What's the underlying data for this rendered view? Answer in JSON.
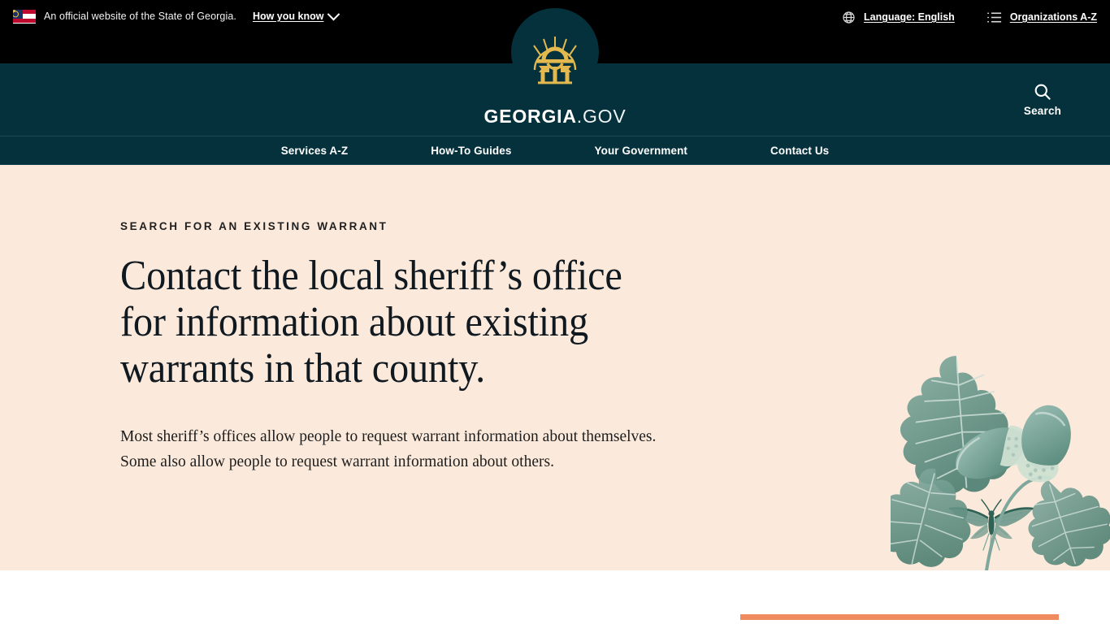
{
  "gov_banner": {
    "flag_icon": "georgia-state-flag-icon",
    "official_text": "An official website of the State of Georgia.",
    "how_you_know_label": "How you know",
    "chevron_icon": "chevron-down-icon",
    "language": {
      "icon": "globe-icon",
      "label": "Language: English"
    },
    "organizations": {
      "icon": "list-icon",
      "label": "Organizations A-Z"
    },
    "background_color": "#000000"
  },
  "header": {
    "seal_icon": "georgia-state-seal-icon",
    "wordmark_bold": "GEORGIA",
    "wordmark_light": ".GOV",
    "search": {
      "icon": "search-icon",
      "label": "Search"
    },
    "background_color": "#04313c"
  },
  "nav": {
    "items": [
      {
        "label": "Services A-Z"
      },
      {
        "label": "How-To Guides"
      },
      {
        "label": "Your Government"
      },
      {
        "label": "Contact Us"
      }
    ]
  },
  "hero": {
    "eyebrow": "SEARCH FOR AN EXISTING WARRANT",
    "title": "Contact the local sheriff’s office for information about existing warrants in that county.",
    "body": "Most sheriff’s offices allow people to request warrant information about themselves. Some also allow people to request warrant information about others.",
    "background_color": "#fbeadb",
    "illustration": {
      "butterfly_icon": "butterfly-illustration",
      "oak_icon": "oak-leaves-and-acorns-illustration",
      "color": "#5e8f82"
    }
  },
  "below_fold": {
    "accent_bar_color": "#ef8b5e"
  }
}
